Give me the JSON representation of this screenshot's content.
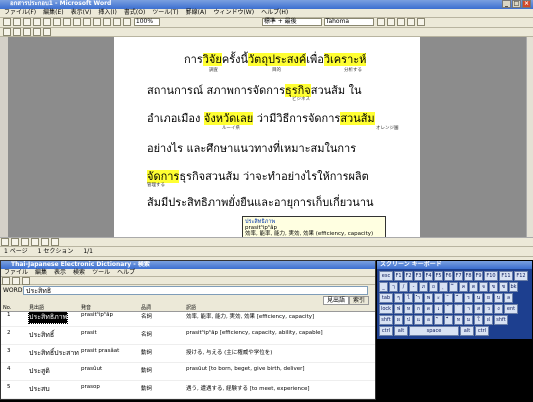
{
  "word": {
    "title": "อกสารประกอบ1 - Microsoft Word",
    "menu": [
      "ファイル(F)",
      "編集(E)",
      "表示(V)",
      "挿入(I)",
      "書式(O)",
      "ツール(T)",
      "罫線(A)",
      "ウィンドウ(W)",
      "ヘルプ(H)"
    ],
    "zoom": "100%",
    "style": "標準 + 最後",
    "font": "Tahoma",
    "status": [
      "1 ページ",
      "1 セクション",
      "1/1"
    ]
  },
  "doc_lines": [
    {
      "parts": [
        "การ",
        "วิจัย",
        "ครั้งนี้",
        "วัตถุประสงค์",
        "เพื่อ",
        "วิเคราะห์"
      ],
      "ann": [
        "調査",
        "目的",
        "分析する"
      ]
    },
    {
      "text": "สถานการณ์ สภาพการจัดการ",
      "hl": "ธุรกิจ",
      "tail": "สวนส้ม ใน",
      "ann": [
        "ビジネス"
      ]
    },
    {
      "text": "อำเภอเมือง ",
      "hl": "จังหวัดเลย",
      "tail": " ว่ามีวิธีการจัดการ",
      "hl2": "สวนส้ม",
      "ann": [
        "ルーイ県",
        "オレンジ園"
      ]
    },
    {
      "text": "อย่างไร และศึกษาแนวทางที่เหมาะสมในการ"
    },
    {
      "hl": "จัดการ",
      "text": "ธุรกิจสวนส้ม ว่าจะทำอย่างไรให้การผลิต",
      "ann": [
        "管理する"
      ]
    },
    {
      "text": "ส้มมีประสิทธิภาพยั่งยืนและอายุการเก็บเกี่ยวนาน"
    }
  ],
  "tooltip": {
    "word": "ประสิทธิภาพ",
    "reading": "prasitʰipʰâp",
    "meaning": "効率, 能率, 能力, 実効, 効果 (efficiency, capacity)"
  },
  "dict": {
    "title": "Thai-Japanese Electronic Dictionary - 検索",
    "menu": [
      "ファイル",
      "編集",
      "表示",
      "検索",
      "ツール",
      "ヘルプ"
    ],
    "word_label": "WORD",
    "query": "ประสิทธิ",
    "tabs": [
      "見出語",
      "索引"
    ],
    "headers": [
      "No.",
      "見出語",
      "発音",
      "品詞",
      "訳語"
    ],
    "rows": [
      {
        "no": "1",
        "head": "ประสิทธิภาพ",
        "pron": "prasitʰipʰâp",
        "pos": "名詞",
        "gloss": "効率, 能率, 能力, 実効, 効果 [efficiency, capacity]"
      },
      {
        "no": "2",
        "head": "ประสิทธิ์",
        "pron": "prasit",
        "pos": "名詞",
        "gloss": "prasitʰipʰâp [efficiency, capacity, ability, capable]"
      },
      {
        "no": "3",
        "head": "ประสิทธิ์ประสาท",
        "pron": "prasit prasâat",
        "pos": "動詞",
        "gloss": "授ける, 与える (主に権威や学位を)"
      },
      {
        "no": "4",
        "head": "ประสูติ",
        "pron": "prasûut",
        "pos": "動詞",
        "gloss": "prasûut [to born, beget, give birth, deliver]"
      },
      {
        "no": "5",
        "head": "ประสบ",
        "pron": "prasop",
        "pos": "動詞",
        "gloss": "遇う, 遭遇する, 経験する [to meet, experience]"
      }
    ]
  },
  "kbd": {
    "title": "スクリーン キーボード",
    "rows": [
      [
        "esc",
        "F1",
        "F2",
        "F3",
        "F4",
        "F5",
        "F6",
        "F7",
        "F8",
        "F9",
        "F10",
        "F11",
        "F12"
      ],
      [
        "_",
        "ๅ",
        "/",
        "-",
        "ภ",
        "ถ",
        "ุ",
        "ึ",
        "ค",
        "ต",
        "จ",
        "ข",
        "ช",
        "bk"
      ],
      [
        "tab",
        "ๆ",
        "ไ",
        "ำ",
        "พ",
        "ะ",
        "ั",
        "ี",
        "ร",
        "น",
        "ย",
        "บ",
        "ล"
      ],
      [
        "lock",
        "ฟ",
        "ห",
        "ก",
        "ด",
        "เ",
        "้",
        "่",
        "า",
        "ส",
        "ว",
        "ง",
        "ent"
      ],
      [
        "shft",
        "ผ",
        "ป",
        "แ",
        "อ",
        "ิ",
        "ื",
        "ท",
        "ม",
        "ใ",
        "ฝ",
        "shft"
      ],
      [
        "ctrl",
        "alt",
        "space",
        "alt",
        "ctrl"
      ]
    ]
  }
}
